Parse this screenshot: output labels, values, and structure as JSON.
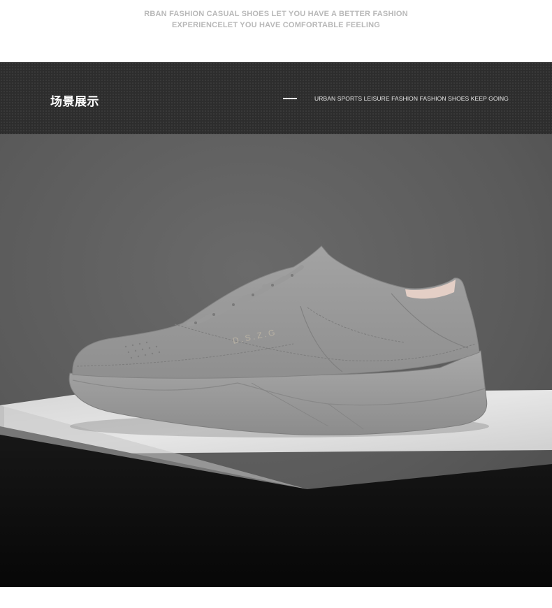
{
  "header": {
    "tagline_line1": "RBAN FASHION CASUAL SHOES LET YOU HAVE A BETTER FASHION",
    "tagline_line2": "EXPERIENCELET YOU HAVE COMFORTABLE FEELING"
  },
  "section": {
    "title": "场景展示",
    "subtitle": "URBAN SPORTS LEISURE FASHION FASHION SHOES KEEP GOING"
  },
  "product": {
    "brand_mark": "D.S.Z.G",
    "color": "#9c9c9c"
  },
  "colors": {
    "band": "#2d2d2d",
    "backdrop": "#5b5b5b",
    "pedestal_top": "#dcdcdc",
    "pedestal_front": "#0e0e0e"
  }
}
